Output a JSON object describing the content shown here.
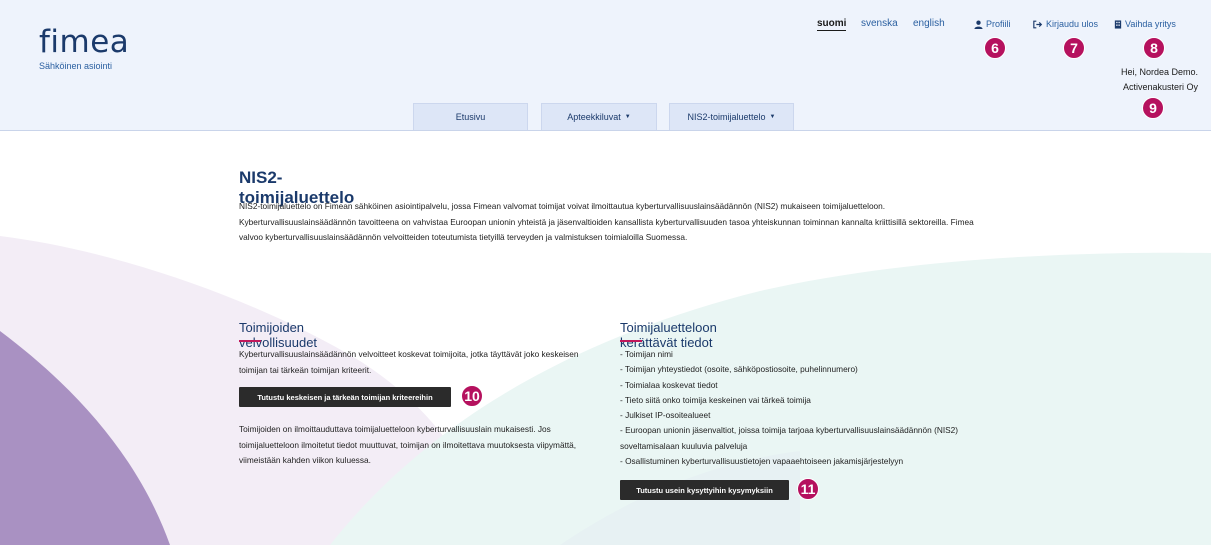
{
  "header": {
    "logo": "fimea",
    "logo_subtitle": "Sähköinen asiointi",
    "languages": [
      "suomi",
      "svenska",
      "english"
    ],
    "active_language": "suomi",
    "profile_label": "Profiili",
    "logout_label": "Kirjaudu ulos",
    "switch_company_label": "Vaihda yritys",
    "greeting_line1": "Hei, Nordea Demo.",
    "greeting_line2": "Activenakusteri Oy",
    "badges": {
      "profile": "6",
      "logout": "7",
      "switch": "8",
      "company": "9"
    }
  },
  "nav": {
    "tabs": [
      {
        "label": "Etusivu"
      },
      {
        "label": "Apteekkiluvat",
        "dropdown": true
      },
      {
        "label": "NIS2-toimijaluettelo",
        "dropdown": true
      }
    ]
  },
  "main": {
    "title": "NIS2-toimijaluettelo",
    "intro": "NIS2-toimijaluettelo on Fimean sähköinen asiointipalvelu, jossa Fimean valvomat toimijat voivat ilmoittautua kyberturvallisuuslainsäädännön (NIS2) mukaiseen toimijaluetteloon. Kyberturvallisuuslainsäädännön tavoitteena on vahvistaa Euroopan unionin yhteistä ja jäsenvaltioiden kansallista kyberturvallisuuden tasoa yhteiskunnan toiminnan kannalta kriittisillä sektoreilla. Fimea valvoo kyberturvallisuuslainsäädännön velvoitteiden toteutumista tietyillä terveyden ja valmistuksen toimialoilla Suomessa.",
    "left": {
      "title": "Toimijoiden velvollisuudet",
      "para1": "Kyberturvallisuuslainsäädännön velvoitteet koskevat toimijoita, jotka täyttävät joko keskeisen toimijan tai tärkeän toimijan kriteerit.",
      "button_label": "Tutustu keskeisen ja tärkeän toimijan kriteereihin",
      "button_badge": "10",
      "para2": "Toimijoiden on ilmoittauduttava toimijaluetteloon kyberturvallisuuslain mukaisesti. Jos toimijaluetteloon ilmoitetut tiedot muuttuvat, toimijan on ilmoitettava muutoksesta viipymättä, viimeistään kahden viikon kuluessa."
    },
    "right": {
      "title": "Toimijaluetteloon kerättävät tiedot",
      "items": [
        "- Toimijan nimi",
        "- Toimijan yhteystiedot (osoite, sähköpostiosoite, puhelinnumero)",
        "- Toimialaa koskevat tiedot",
        "- Tieto siitä onko toimija keskeinen vai tärkeä toimija",
        "- Julkiset IP-osoitealueet",
        "- Euroopan unionin jäsenvaltiot, joissa toimija tarjoaa kyberturvallisuuslainsäädännön (NIS2) soveltamisalaan kuuluvia palveluja",
        "- Osallistuminen kyberturvallisuustietojen vapaaehtoiseen jakamisjärjestelyyn"
      ],
      "button_label": "Tutustu usein kysyttyihin kysymyksiin",
      "button_badge": "11"
    }
  },
  "colors": {
    "brand_navy": "#1b3a6b",
    "link_blue": "#2a5fa0",
    "badge_magenta": "#b5115e",
    "header_bg": "#eef3fc",
    "button_dark": "#2b2b2b"
  }
}
